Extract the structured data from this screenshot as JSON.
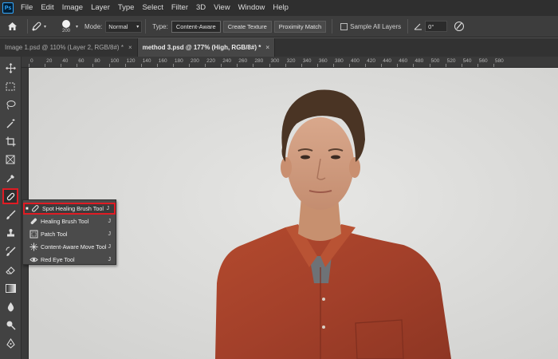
{
  "menu": {
    "logo": "Ps",
    "items": [
      "File",
      "Edit",
      "Image",
      "Layer",
      "Type",
      "Select",
      "Filter",
      "3D",
      "View",
      "Window",
      "Help"
    ]
  },
  "options": {
    "brush_size": "200",
    "mode_label": "Mode:",
    "mode_value": "Normal",
    "type_label": "Type:",
    "type_buttons": [
      "Content-Aware",
      "Create Texture",
      "Proximity Match"
    ],
    "sample_all_layers": "Sample All Layers",
    "angle_value": "0°"
  },
  "tabs": [
    {
      "label": "Image 1.psd @ 110% (Layer 2, RGB/8#) *",
      "active": false
    },
    {
      "label": "method 3.psd @ 177% (High, RGB/8#) *",
      "active": true
    }
  ],
  "ruler": {
    "ticks": [
      "0",
      "20",
      "40",
      "60",
      "80",
      "100",
      "120",
      "140",
      "160",
      "180",
      "200",
      "220",
      "240",
      "260",
      "280",
      "300",
      "320",
      "340",
      "360",
      "380",
      "400",
      "420",
      "440",
      "460",
      "480",
      "500",
      "520",
      "540",
      "560",
      "580"
    ]
  },
  "flyout": {
    "items": [
      {
        "label": "Spot Healing Brush Tool",
        "key": "J",
        "icon": "spot-healing-brush-icon",
        "selected": true
      },
      {
        "label": "Healing Brush Tool",
        "key": "J",
        "icon": "healing-brush-icon",
        "selected": false
      },
      {
        "label": "Patch Tool",
        "key": "J",
        "icon": "patch-icon",
        "selected": false
      },
      {
        "label": "Content-Aware Move Tool",
        "key": "J",
        "icon": "content-aware-move-icon",
        "selected": false
      },
      {
        "label": "Red Eye Tool",
        "key": "J",
        "icon": "red-eye-icon",
        "selected": false
      }
    ]
  },
  "colors": {
    "highlight": "#e01c24",
    "shirt": "#a9432a",
    "canvas_bg": "#dededc"
  }
}
